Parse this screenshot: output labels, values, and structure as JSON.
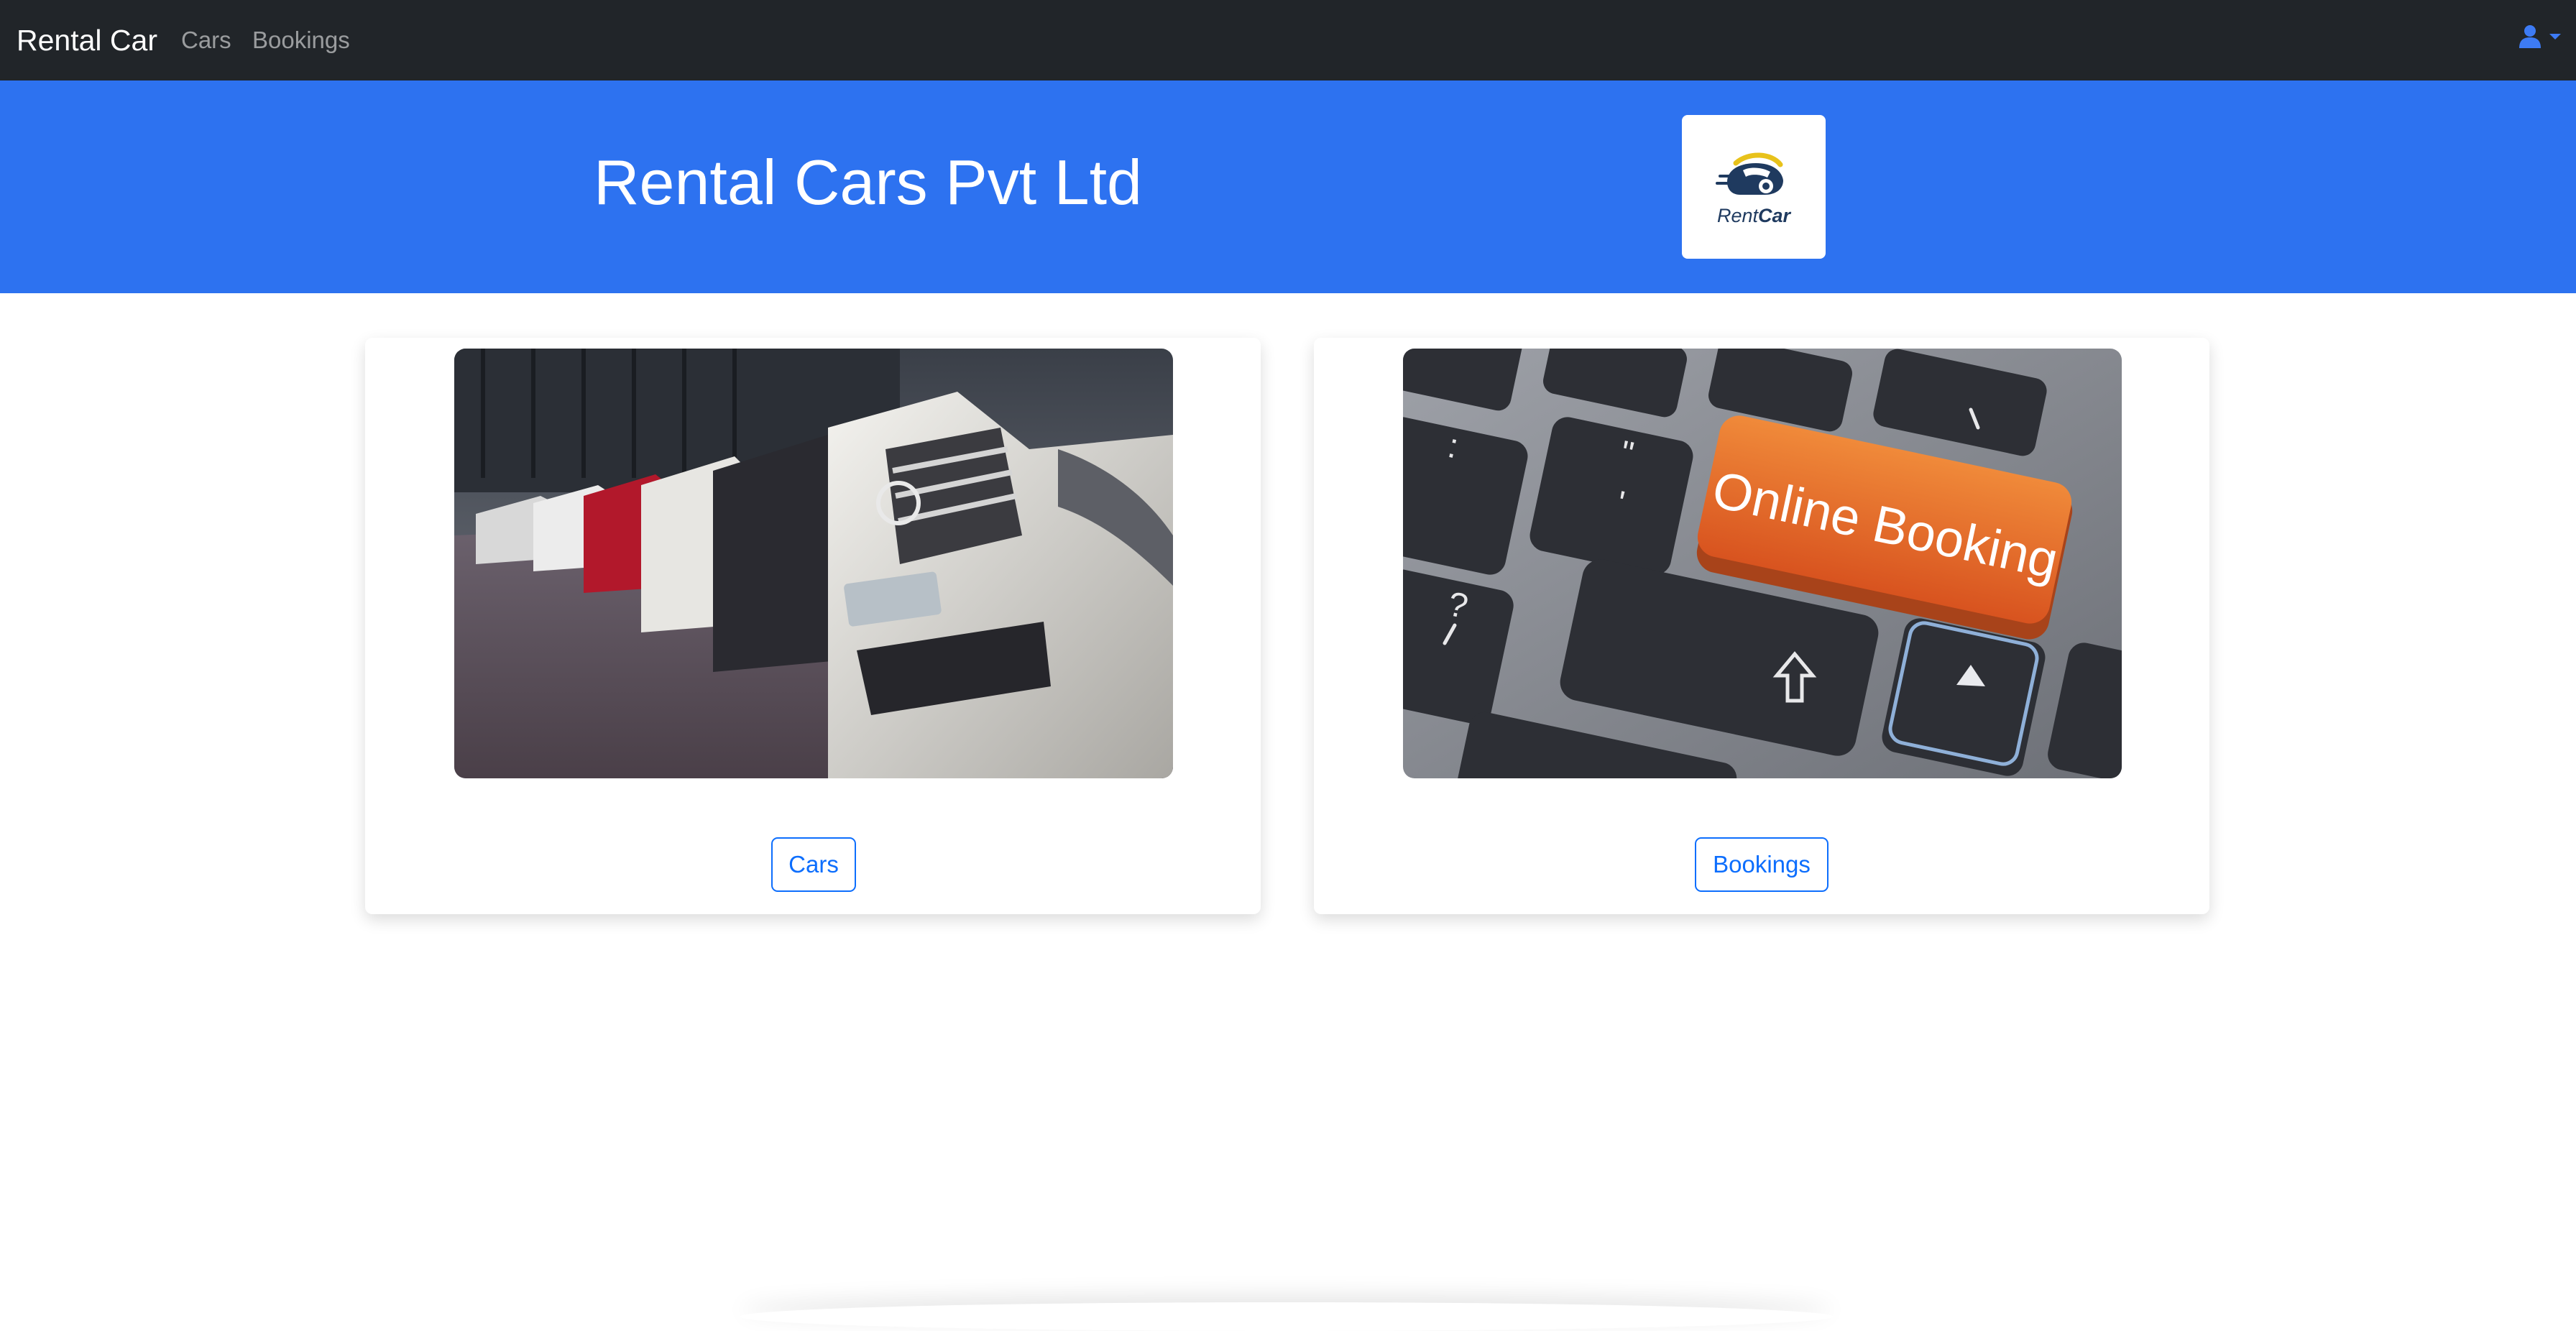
{
  "navbar": {
    "brand": "Rental Car",
    "links": [
      {
        "label": "Cars"
      },
      {
        "label": "Bookings"
      }
    ],
    "user_icon": "user-icon",
    "user_caret_icon": "caret-down-icon"
  },
  "hero": {
    "title": "Rental Cars Pvt Ltd",
    "logo": {
      "text_regular": "Rent",
      "text_bold": "Car"
    }
  },
  "cards": [
    {
      "image": "parked-cars-photo",
      "button_label": "Cars"
    },
    {
      "image": "online-booking-keyboard-photo",
      "image_text": "Online Booking",
      "button_label": "Bookings"
    }
  ],
  "colors": {
    "navbar_bg": "#212529",
    "hero_bg": "#2d72f0",
    "accent": "#0d6efd",
    "booking_key": "#e8672a"
  }
}
